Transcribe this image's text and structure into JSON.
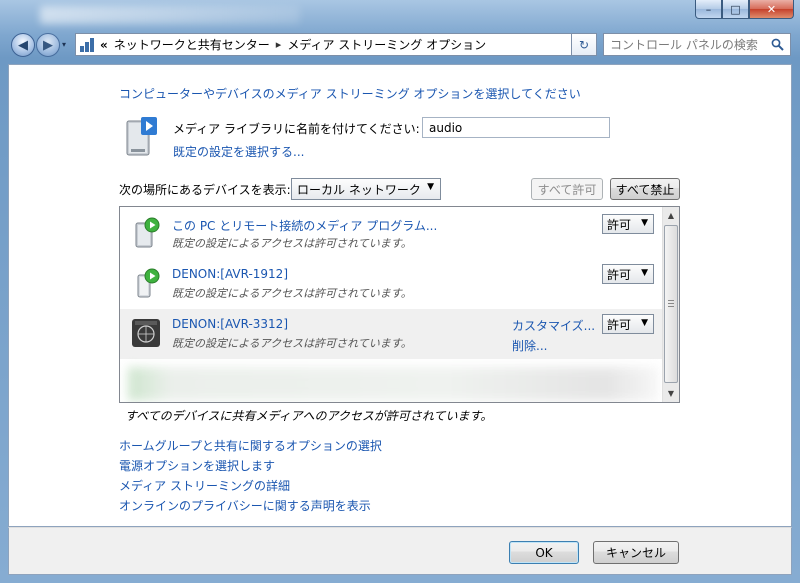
{
  "window": {
    "caption_minimize": "–",
    "caption_maximize": "□",
    "caption_close": "✕"
  },
  "nav": {
    "back_glyph": "◀",
    "forward_glyph": "▶",
    "dropdown_glyph": "▾"
  },
  "address": {
    "prefix": "«",
    "crumb_1": "ネットワークと共有センター",
    "separator": "▸",
    "crumb_2": "メディア ストリーミング オプション",
    "dropdown_glyph": "▾"
  },
  "refresh_glyph": "↻",
  "search": {
    "placeholder": "コントロール パネルの検索"
  },
  "main": {
    "heading": "コンピューターやデバイスのメディア ストリーミング オプションを選択してください",
    "library_label": "メディア ライブラリに名前を付けてください:",
    "library_value": "audio",
    "defaults_link": "既定の設定を選択する...",
    "show_devices_label": "次の場所にあるデバイスを表示:",
    "location_select": "ローカル ネットワーク",
    "allow_all": "すべて許可",
    "block_all": "すべて禁止",
    "all_allowed_note": "すべてのデバイスに共有メディアへのアクセスが許可されています。"
  },
  "devices": [
    {
      "name": "この PC とリモート接続のメディア プログラム...",
      "status": "既定の設定によるアクセスは許可されています。",
      "permission": "許可"
    },
    {
      "name": "DENON:[AVR-1912]",
      "status": "既定の設定によるアクセスは許可されています。",
      "permission": "許可"
    },
    {
      "name": "DENON:[AVR-3312]",
      "status": "既定の設定によるアクセスは許可されています。",
      "permission": "許可",
      "customize": "カスタマイズ...",
      "remove": "削除..."
    }
  ],
  "links": [
    "ホームグループと共有に関するオプションの選択",
    "電源オプションを選択します",
    "メディア ストリーミングの詳細",
    "オンラインのプライバシーに関する声明を表示"
  ],
  "footer": {
    "ok": "OK",
    "cancel": "キャンセル"
  },
  "colors": {
    "link": "#1a56b0",
    "frame": "#7fa7cf",
    "selected_row": "#f0f0f0"
  }
}
